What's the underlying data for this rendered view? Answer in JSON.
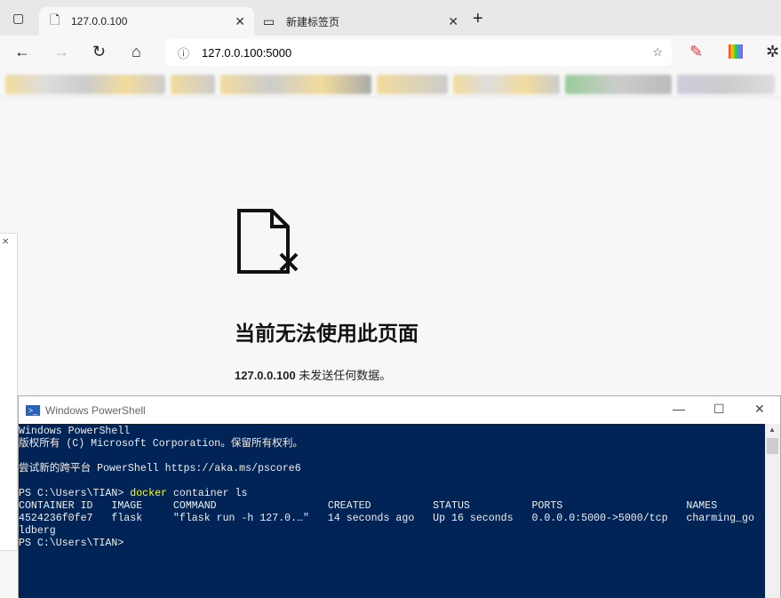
{
  "browser": {
    "tabs": [
      {
        "label": "127.0.0.100",
        "active": true
      },
      {
        "label": "新建标签页",
        "active": false
      }
    ],
    "address": "127.0.0.100:5000"
  },
  "error": {
    "title": "当前无法使用此页面",
    "host": "127.0.0.100",
    "desc": " 未发送任何数据。"
  },
  "powershell": {
    "title": "Windows PowerShell",
    "lines": [
      "Windows PowerShell",
      "版权所有 (C) Microsoft Corporation。保留所有权利。",
      "",
      "尝试新的跨平台 PowerShell https://aka.ms/pscore6",
      ""
    ],
    "prompt": "PS C:\\Users\\TIAN> ",
    "command_kw": "docker",
    "command_rest": " container ls",
    "output": [
      "CONTAINER ID   IMAGE     COMMAND                  CREATED          STATUS          PORTS                    NAMES",
      "4524236f0fe7   flask     \"flask run -h 127.0.…\"   14 seconds ago   Up 16 seconds   0.0.0.0:5000->5000/tcp   charming_go",
      "ldberg"
    ],
    "final_prompt": "PS C:\\Users\\TIAN>"
  },
  "colors": {
    "console_bg": "#012456",
    "keyword": "#ffff00"
  }
}
